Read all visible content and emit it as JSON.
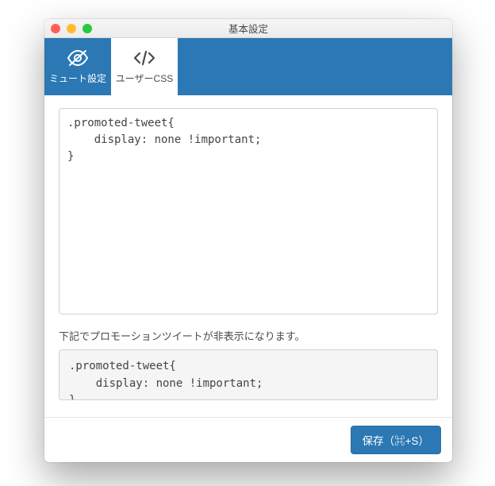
{
  "window": {
    "title": "基本設定"
  },
  "tabs": {
    "mute": {
      "label": "ミュート設定"
    },
    "usercss": {
      "label": "ユーザーCSS"
    }
  },
  "editor": {
    "css_value": ".promoted-tweet{\n    display: none !important;\n}"
  },
  "help": {
    "text": "下記でプロモーションツイートが非表示になります。",
    "example": ".promoted-tweet{\n    display: none !important;\n}"
  },
  "footer": {
    "save_label": "保存（⌘+S）"
  }
}
